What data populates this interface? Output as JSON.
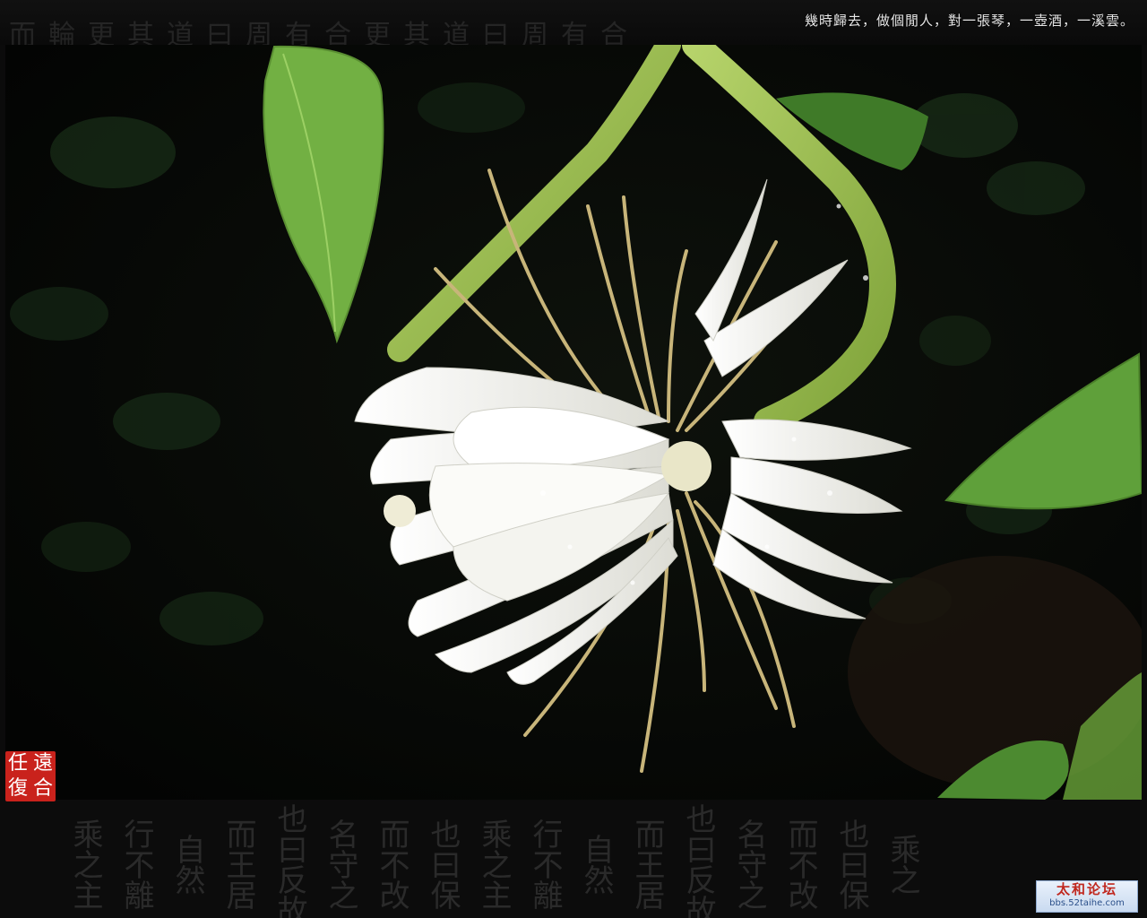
{
  "header": {
    "caption": "幾時歸去，做個閒人，對一張琴，一壺酒，一溪雲。",
    "background_calligraphy": "而輪更其道曰周有合更其道曰周有合"
  },
  "footer": {
    "calligraphy_columns": [
      "乘之主",
      "行不離",
      "自然",
      "而王居",
      "也曰反故",
      "名守之",
      "而不改",
      "也曰保",
      "乘之主",
      "行不離",
      "自然",
      "而王居",
      "也曰反故",
      "名守之",
      "而不改",
      "也曰保",
      "乘之"
    ]
  },
  "seal": {
    "chars": [
      "任",
      "遠",
      "復",
      "合"
    ],
    "color": "#c9221c"
  },
  "watermark": {
    "title": "太和论坛",
    "url": "bbs.52taihe.com"
  },
  "photo": {
    "subject_colors": {
      "petal": "#f4f4f0",
      "stem": "#9fc24a",
      "leaf": "#6aa43a",
      "background": "#060806"
    }
  }
}
